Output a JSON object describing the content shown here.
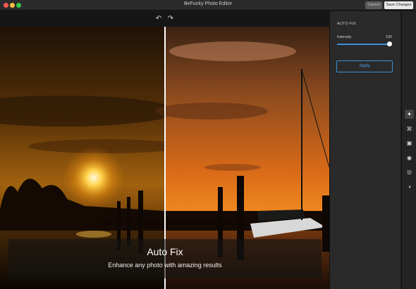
{
  "window": {
    "title": "BeFunky Photo Editor",
    "cancel_label": "Cancel",
    "save_label": "Save Changes"
  },
  "toolbar": {
    "undo_icon": "undo-icon",
    "redo_icon": "redo-icon"
  },
  "overlay": {
    "title": "Auto Fix",
    "subtitle": "Enhance any photo with amazing results"
  },
  "panel": {
    "title": "AUTO FIX",
    "intensity_label": "Intensity",
    "intensity_value": "100",
    "intensity_fraction": 1.0,
    "apply_label": "Apply"
  },
  "tools": [
    {
      "icon": "magic-wand-icon",
      "active": true
    },
    {
      "icon": "crop-move-icon",
      "active": false
    },
    {
      "icon": "exposure-icon",
      "active": false
    },
    {
      "icon": "enhance-icon",
      "active": false
    },
    {
      "icon": "eye-icon",
      "active": false
    },
    {
      "icon": "contrast-icon",
      "active": false
    }
  ],
  "colors": {
    "accent": "#3e8fd6",
    "panel_bg": "#2a2a2a",
    "titlebar_bg": "#2b2b2b"
  }
}
